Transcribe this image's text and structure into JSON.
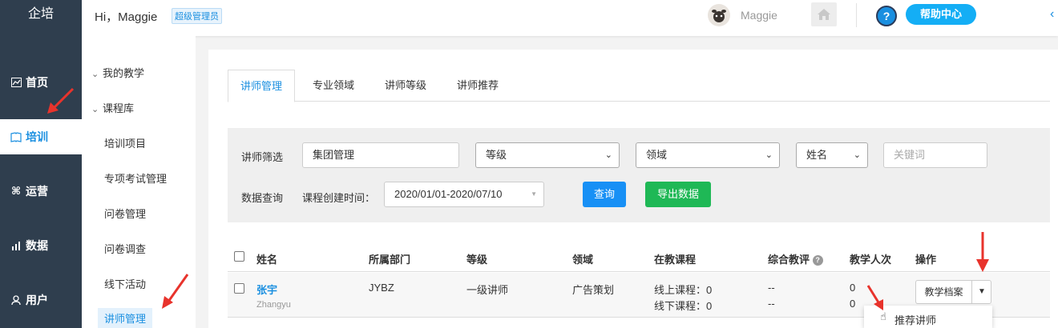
{
  "brand": "企培",
  "rail": [
    {
      "label": "首页",
      "icon": "chart-icon",
      "glyph": "📈"
    },
    {
      "label": "培训",
      "icon": "book-icon",
      "glyph": "📖"
    },
    {
      "label": "运营",
      "icon": "command-icon",
      "glyph": "⌘"
    },
    {
      "label": "数据",
      "icon": "bar-chart-icon",
      "glyph": "📶"
    },
    {
      "label": "用户",
      "icon": "user-icon",
      "glyph": "👤"
    }
  ],
  "header": {
    "greeting": "Hi，Maggie",
    "role": "超级管理员",
    "username": "Maggie",
    "help_q": "?",
    "help_label": "帮助中心",
    "collapse_glyph": "‹"
  },
  "subnav": {
    "groups": [
      "我的教学",
      "课程库"
    ],
    "items": [
      "培训项目",
      "专项考试管理",
      "问卷管理",
      "问卷调查",
      "线下活动",
      "讲师管理"
    ]
  },
  "tabs": [
    "讲师管理",
    "专业领域",
    "讲师等级",
    "讲师推荐"
  ],
  "filter": {
    "label_filter": "讲师筛选",
    "group_value": "集团管理",
    "level_select": "等级",
    "domain_select": "领域",
    "name_select": "姓名",
    "keyword_placeholder": "关键词",
    "label_query": "数据查询",
    "date_label": "课程创建时间：",
    "date_value": "2020/01/01-2020/07/10",
    "query_btn": "查询",
    "export_btn": "导出数据"
  },
  "table": {
    "columns": [
      "姓名",
      "所属部门",
      "等级",
      "领域",
      "在教课程",
      "综合教评",
      "教学人次",
      "操作"
    ],
    "rows": [
      {
        "name": "张宇",
        "pinyin": "Zhangyu",
        "dept": "JYBZ",
        "level": "一级讲师",
        "domain": "广告策划",
        "online": "线上课程：0",
        "offline": "线下课程：0",
        "eval1": "--",
        "eval2": "--",
        "count1": "0",
        "count2": "0",
        "action": "教学档案"
      }
    ]
  },
  "dropdown_option": "推荐讲师",
  "accent": "#1a8fe0",
  "arrow_color": "#e8332c"
}
